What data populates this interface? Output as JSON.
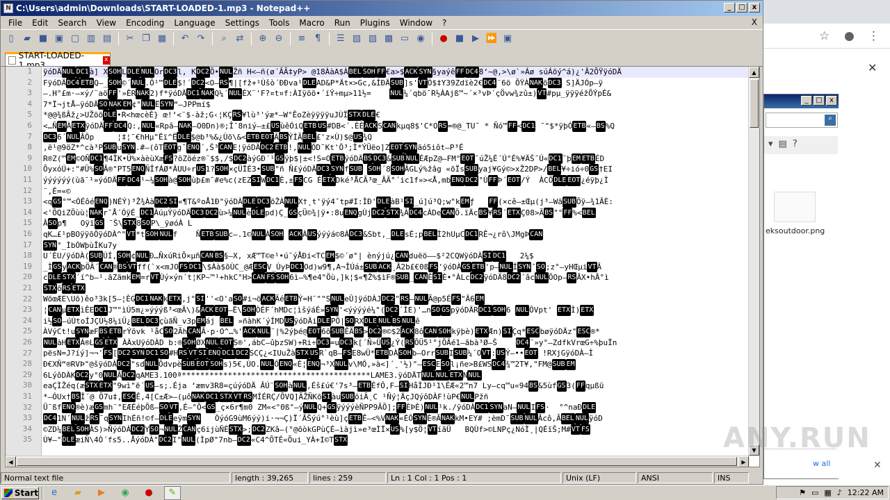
{
  "window": {
    "title": "C:\\Users\\admin\\Downloads\\START-LOADED-1.mp3 - Notepad++"
  },
  "menu": [
    "File",
    "Edit",
    "Search",
    "View",
    "Encoding",
    "Language",
    "Settings",
    "Tools",
    "Macro",
    "Run",
    "Plugins",
    "Window",
    "?"
  ],
  "menu_close": "X",
  "tab": {
    "label": "START-LOADED-1.mp3",
    "close": "x"
  },
  "editor": {
    "line_numbers": [
      "1",
      "2",
      "3",
      "4",
      "5",
      "6",
      "7",
      "8",
      "9",
      "10",
      "11",
      "12",
      "13",
      "14",
      "15",
      "16",
      "17",
      "18",
      "19",
      "20",
      "21",
      "22",
      "23",
      "24",
      "25",
      "26",
      "27",
      "28",
      "29",
      "30",
      "31",
      "32",
      "33",
      "34",
      "35"
    ],
    "lines": [
      "ÿóDÄNULDC1à] XSOHLDLENULOrDC3l, KDC2Õ•NULŽñ H<–ñ(ø´ÂÃ‡yP> @18ÀàA$ÀBELSOHFF€a>$ACKSYN§yaýêFFDC48‘~@,>\\ø`»Áø súÁõý^á)¿'Â2ÕŸÿóDÄ",
      "FÿóDÄDC4ETBQ–_SOH©´NUL.Õ¹™DLE$!´DC2<O–RS¶|[fž+¹Ùšò´ÐÐva¹DLEAD&P*Ät×>Gc,&ÍÐÄSUB]s'VTÓ$‡Y39Zdïè2€DC4¨6ö ÕŸÀNAKõDC3 S]ÄJÓp–ÿ",
      "–.H°£m·–×ý/¨aöFF'»ÈRNAK2)f*ÿóDÄDC1NAKQ¼´NULÈX¨'F?¤t¤f:ÀIÿöö•´íÝ÷mµ>11½=    NUL¼´qbö¯R½ÀAjß™~´×³vÞ´çÖvw¾zû±)VT#pµ_ÿÿÿéžÕÝpÉ&",
      "7*Ï¬jtÅ–ÿóDÄSONAKEM¢°NULËSYN“–JPPmí$",
      "*@@¾ßÂž¿>UŽöõDLE•R<hœcèÈ} œ!‘<¨$-àž;G‹¦KÇRS¥lù³'ýæ*–W°ÊoZèÿÿÿÿuJÙÏSTXDLE€",
      "<…ÑEMÀETXÿóDÄFFDC4Q:,NUL«Rpâ–NAK–O0Dn)®;Î¯8niý–±£USùêÓiQETBUS#DB<´.ÈÈACKSCANkµq8$'C*ORS=®@_TU¯ * Ñó™FF<DC1 ¯\"$*ÿþÓETB«–BS%Q",
      "DC36´NULÂÔp     ¦‡¦¯€hHµ\"Ëï^ËDLE$@b³%&¿Ùõ\\&<ETBEOTÃBSÝÌÃBEL£'z×Ù)$@US¾Q",
      ",ë¹@9öZ*^cà³PSUBuSYN.#–(ôTEOTg¯ENQ´,Š³CANE¦ÿóDÄDC2ETB!,NULÓD¯Kt'Ô³;Ì*ÝÜëo]ZEOTSYNäó5iôt–P³É",
      "R®Z(™EM©OÑDC1¶4ÏK•Ü%×àèùXæFS?öZöéz®¨$$,/$DC2àýGÐ´¹GSÿþ$|±<!S=OETBÿóDÄBSDC3&SUBNULÉÆpZ@–FM°EOT¯úŽ¼È´Ú°É%¥ÄŠ¯Ú«DC1¯þEMETBÉD",
      "ÕyxóÚ+:\"#Ü%SOÂ®\"PT5ENQÑÎfÁØ*ÀUU÷rUS1?SOH×çÜÏÉ3•SUB°ñ Ñ£ýóDÄDC3SYNfSUB SOH´8SOHÂGLý%žâg «õÏsSUByaj¥Gý©>xŽ2DP>/BEL¥÷ió÷0GS†EI",
      "ýýýýýý(ùã¯¹»ýóDÄFFDC4¹~¼SOHà@SOHùþ£m¯#e%c(zEZSIWDC1È,±FSCG ÉETXDké³ÅCÃ³œ_ÂÃ°´ic1f»><Å,mbENQDC2°ÙFFÞ´EOT/Ý  ÀCÕDLEEOT¿éÿþ¿Ì",
      "¨,É=«©",
      "<qGS°™<ÓÉôéENQ)NÉÝ)³Ž¾ÀàDC2SI«¶T&ºoÅ1Ð\"ÿóDÀDLEDC3õŽÀNULX†¸t'ÿý4¯tp#I:ÌÐ'DLEàB¹SI_ú]ú³Q;w\"kEMƒ   FF(×cê–±Œµ(j³–WãSUBÕÿ–¾1ÂÈ:",
      "<'ÕQiZÖùù¦NAKr¯Å´ÓÿÉ_DC1ÀúµÝÿóDÄDC3DC2ù>¼NULèDLEpd)Ç_GSçÜ©¾|ÿ•:8uENQgÚjDC2STX¾ÀDC4cÀDeCANÖ.ïÄcBS¥RS´ETXÇ08>ÃBS\"°FF%<BEL",
      "ÂSOp¶   OÿïGS ¯Š\\STX8SOP\\_ÿøóÀ L",
      "qK…£¹pBOÿÿõÔÿóDÀ^\"VT*tSOHNULf    ÑETBSUBc–.1©NULÀSOH ACKÀUSýýýá©8ÀDC3&Sbt,_DLEsÉ;pBELÌ2hUµCDC1RÊ¬¿rô\\JMgÞCAN",
      "SYN°_ÌbÓWþùÎKu7y",
      "U´ÈU/ÿóDÀ(SUBÚÍ,SOH¢NULÐ…ÑxúRiÕ×µñCANBS§–X, xÆ™T©e¹•ú¯ýÅÐi<TCEM$©´ø°| ènýjú¿CANduëö––$²2CQWÿóDÀSIDC1   2¼$",
      "_ÌGSyACKþÖÃ´CAN®BSVTff(`x<mJOFSDC1\\$Àà$õÙC_@ÆESCV_ÙyÞDC1Od)w9¶,A¬ÎÚá±SUBACK¸Â2b£€0ßFS'ÿóDÀGSETB'p–NULÍSYN¯SO;z°–yHŒµiVTÂ",
      "cDLESTX´í^b–¹.ãZämkEM=rVTÙý×ýn´t¦KP~™¹+hkC°H>CANFSSOH6ì–%¶e4°Öù,]k¦$«¶Ž%$ìF®SUB_CANÊSIÈ•°ÀLcDC2ÿóDÄ8DC2´âcNULÖOp–RSÂX•hÂ°ì",
      "STXõRSETX",
      "WõœÆE\\Uõ)êo³3k[5–¦ÈGDC1NAKkETX,j°SI''<O'aSO#i¬öACKÃéETBÝ=H¨\"\"SNULeÛ]ÿóDÀJDC2\"RS–NULÃ@p5ÉFS\"Â6EM",
      "¦CANµETXìÊEDC1J™\"ìÚ5m¿»ýýýß³<œÂ\\)&ACKEOT–Ë\\SOHÒÉF´hMDc¦ìšýáÉ»SYN'<ýýýýé¼\"(DC2´ÌE)'…nSOGSpÿóDÄRDC1SOH6 NULÔVpt' ETXÌ)ETX",
      "i½SO–úÙtoÍJÇÙ½8¼iÜ¿BELDC3çùãÑ_v3pEMáj BEL »ñàhK´ýÍMDUSÿóDÄiDLEPÖ|SORXDLENULBSNULê",
      "ÀVýCt!uSYNæFBSETBrÝövk ¹åCSO2ÃhCANÂ·p·O^…%'ACKNUL¨|%2ýþé@EOT6õSUBÊÄBS>DC2®©$2ACK8ôCANSOHkÿþè)ETXÆn)SIÇq*ESCbøÿóDÄz\"ESC®*",
      "NULàHETXÁ®LGSETX ÀÀxUÿóDÀD b:®SOHØXNULEOTS®',ábC–ûþzSW)+Ri÷DC3=uDC3k[´Ñ»ÛUS¿Ý(RSÕÜ5¹°jÕÂé1–ãbà³Ø–Š    DC4¨»y°–ZdfkVrœG÷%þuÏn",
      "pësN=J?íý]¬¬'FS[DC2SYNDC1SO#HRSVTSIENQDC1DC2SCÇ¿<IUuŽàSTXUSR`qB–FSE8wÜ*ETBDÀSOHb–OrrSUBISUB¼´OVT:USÝ–••EOT !RXjGÿóDÀ–Ì",
      "Ð€XÑ“®RVÞ\"@šÿóDÀDC2\"sdNULÕdvpèSUBEOTSOHs)5€,ÙO.NULÔENQ«È¦ENQ¬³XNULv\\MÔ,»à<]´¸'½)\"–ESCESOl¡ñe>B£WSDC4¾™2T¥,\"FM@SUBEM",
      "6LýôDÀKDC2y°0NULÂDC2qAME3.100ª*****************************************LAME3.ÿóDÄTNULNULETXNNUL",
      "eaÇÌŽéq(æSTXETX\"9wì\"ë´US–s;.Éja ‘æmv3R8=çúýóDÄ ÂÚ¨SOHàNUL,Éš£ú€'7s³–ETBÉfÔ,F–SIHåÌJÐ¹1\\ÉÆ«2™n7 Ly–cq™u«94BS&5ùfGS3(FFqµßü",
      "*–ÓUx†BSÎ´@ Ö7u‡,ESCÊ,4[C±Æ>–(µôNAKDC1STXVTRSMÍÉRÇ/ÕVQ]ÃŽÑKõSIàuSUBöiÃ¸C ¹Ñý¦ÄçJQýôDÀF!ùP€NULPžñ",
      "Ü¯ßfENQ®è)æGSmh¨°EÆÉéþÕß–SOVT,É–°Õ<GS_ç×6r¶m0 ZM«<°0ß°–ýNULQ+GSÿýýýèÑPP9ÃÕ];FFÈÞÈ)NUL¹k./ÿóDÀDC1SYNaN–NULIFS·  °^naÐDLE",
      "DC41N´NULžRS¯qSYNIhÉñ!©f–DLEeÿmSYN   ÒýóG9ùM6ýý)i·¬¬Ç)Ï´ÂŠýú°¹èù]çETBÊ–<%VNAK«ÉÔSYNÈ®ÃNAKkM•EY# ;èmD¯SUBNULÂcô,ÃBELNULÿóD",
      "©ZD¼BELSOHÀS)>ÑýóDÀDC2YSO¬NULŽCANç6ijùÑÈSTX>;DC2ZKâ–(°@õòkGPùÇÉ–ìàjì»e³œÌÏ×US%[y$Ö¦VTíãÜ   BQÙf>©LNPç¿NóÌ¸|QÉïŠ;M#VTFS",
      "Ù¥–°DLEæiÑ\\4Ò´fs5..ÅýóDÀ°DC2I\"NUL(ÌpØ\"7nb–DC2«C4^ÕTÉ«Õui_YÀ+I©TSTX"
    ]
  },
  "status": {
    "type": "Normal text file",
    "length": "length : 39,265",
    "lines": "lines : 259",
    "pos": "Ln : 1    Col : 1    Pos : 1",
    "eol": "Unix (LF)",
    "encoding": "ANSI",
    "mode": "INS"
  },
  "right_window": {
    "filename": "eksoutdoor.png",
    "link_text": "w all"
  },
  "taskbar": {
    "start": "Start",
    "time": "12:22 AM"
  },
  "watermark": "ANY.RUN"
}
